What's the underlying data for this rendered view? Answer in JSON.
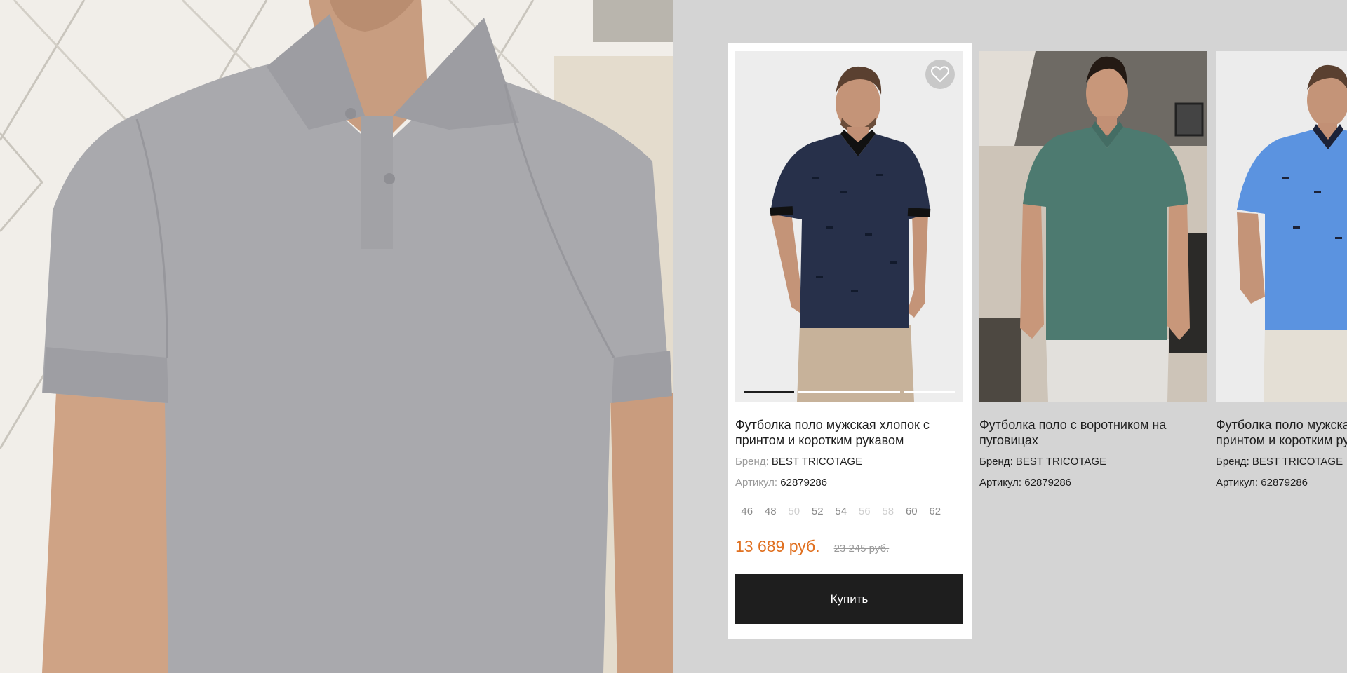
{
  "products": [
    {
      "title": "Футболка поло мужская хлопок с принтом и коротким рукавом",
      "brand_label": "Бренд:",
      "brand": "BEST TRICOTAGE",
      "sku_label": "Артикул:",
      "sku": "62879286",
      "sizes": [
        {
          "label": "46",
          "available": true
        },
        {
          "label": "48",
          "available": true
        },
        {
          "label": "50",
          "available": false
        },
        {
          "label": "52",
          "available": true
        },
        {
          "label": "54",
          "available": true
        },
        {
          "label": "56",
          "available": false
        },
        {
          "label": "58",
          "available": false
        },
        {
          "label": "60",
          "available": true
        },
        {
          "label": "62",
          "available": true
        }
      ],
      "price": "13 689 руб.",
      "old_price": "23 245 руб.",
      "buy_label": "Купить",
      "shirt_color": "#27304a",
      "photo_slides": 3,
      "active_slide": 1
    },
    {
      "title": "Футболка поло с воротником на пуговицах",
      "brand_label": "Бренд:",
      "brand": "BEST TRICOTAGE",
      "sku_label": "Артикул:",
      "sku": "62879286",
      "shirt_color": "#4d7a70"
    },
    {
      "title": "Футболка поло мужская хлопок с принтом и коротким рукавом",
      "brand_label": "Бренд:",
      "brand": "BEST TRICOTAGE",
      "sku_label": "Артикул:",
      "sku": "62879286",
      "shirt_color": "#5b93e0"
    }
  ],
  "colors": {
    "accent_price": "#e07020",
    "button_bg": "#1e1e1e",
    "page_bg": "#d4d4d4",
    "hero_shirt": "#a9a9ad"
  },
  "icons": {
    "favorite": "heart-icon"
  }
}
